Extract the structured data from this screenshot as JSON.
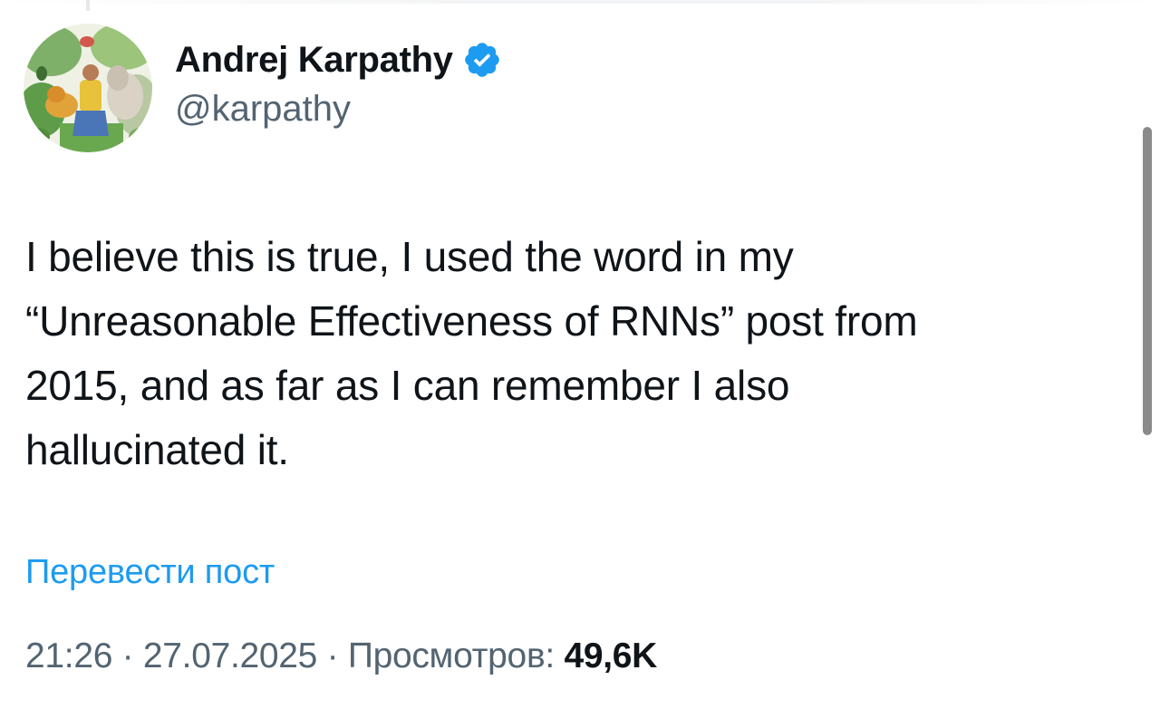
{
  "author": {
    "display_name": "Andrej Karpathy",
    "handle": "@karpathy",
    "verified": true,
    "verified_color": "#1d9bf0",
    "avatar_icon": "avatar-illustration"
  },
  "tweet": {
    "lines": [
      "I believe this is true, I used the word in my",
      "“Unreasonable Effectiveness of RNNs” post from",
      "2015, and as far as I can remember I also",
      "hallucinated it."
    ]
  },
  "translate": {
    "label": "Перевести пост",
    "color": "#1d9bf0"
  },
  "meta": {
    "time": "21:26",
    "separator": " · ",
    "date": "27.07.2025",
    "views_label": "Просмотров:",
    "views_count": "49,6K"
  },
  "colors": {
    "text_primary": "#0f1419",
    "text_secondary": "#536471",
    "accent": "#1d9bf0"
  }
}
